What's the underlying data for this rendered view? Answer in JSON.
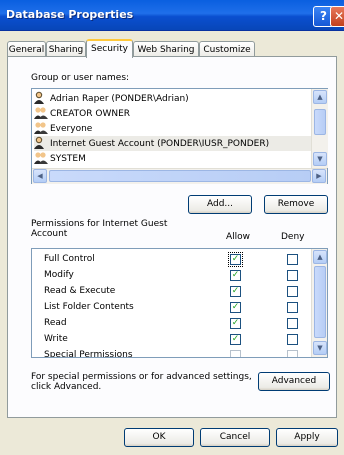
{
  "window": {
    "title": "Database Properties"
  },
  "tabs": [
    "General",
    "Sharing",
    "Security",
    "Web Sharing",
    "Customize"
  ],
  "active_tab": "Security",
  "group_label": "Group or user names:",
  "users": [
    "Adrian Raper (PONDER\\Adrian)",
    "CREATOR OWNER",
    "Everyone",
    "Internet Guest Account (PONDER\\IUSR_PONDER)",
    "SYSTEM"
  ],
  "selected_user": "Internet Guest Account (PONDER\\IUSR_PONDER)",
  "buttons": {
    "add": "Add...",
    "remove": "Remove",
    "advanced": "Advanced",
    "ok": "OK",
    "cancel": "Cancel",
    "apply": "Apply"
  },
  "permissions": {
    "label_line1": "Permissions for Internet Guest",
    "label_line2": "Account",
    "allow_header": "Allow",
    "deny_header": "Deny",
    "rows": [
      {
        "name": "Full Control",
        "allow": true,
        "deny": false
      },
      {
        "name": "Modify",
        "allow": true,
        "deny": false
      },
      {
        "name": "Read & Execute",
        "allow": true,
        "deny": false
      },
      {
        "name": "List Folder Contents",
        "allow": true,
        "deny": false
      },
      {
        "name": "Read",
        "allow": true,
        "deny": false
      },
      {
        "name": "Write",
        "allow": true,
        "deny": false
      },
      {
        "name": "Special Permissions",
        "allow": false,
        "deny": false
      }
    ]
  },
  "advanced_note_line1": "For special permissions or for advanced settings,",
  "advanced_note_line2": "click Advanced.",
  "colors": {
    "titlebar": "#0a5fe0",
    "face": "#ece9d8",
    "check": "#21a121"
  },
  "icons": {
    "user": "user-icon",
    "group": "group-icon",
    "help": "help-icon",
    "close": "close-icon"
  }
}
